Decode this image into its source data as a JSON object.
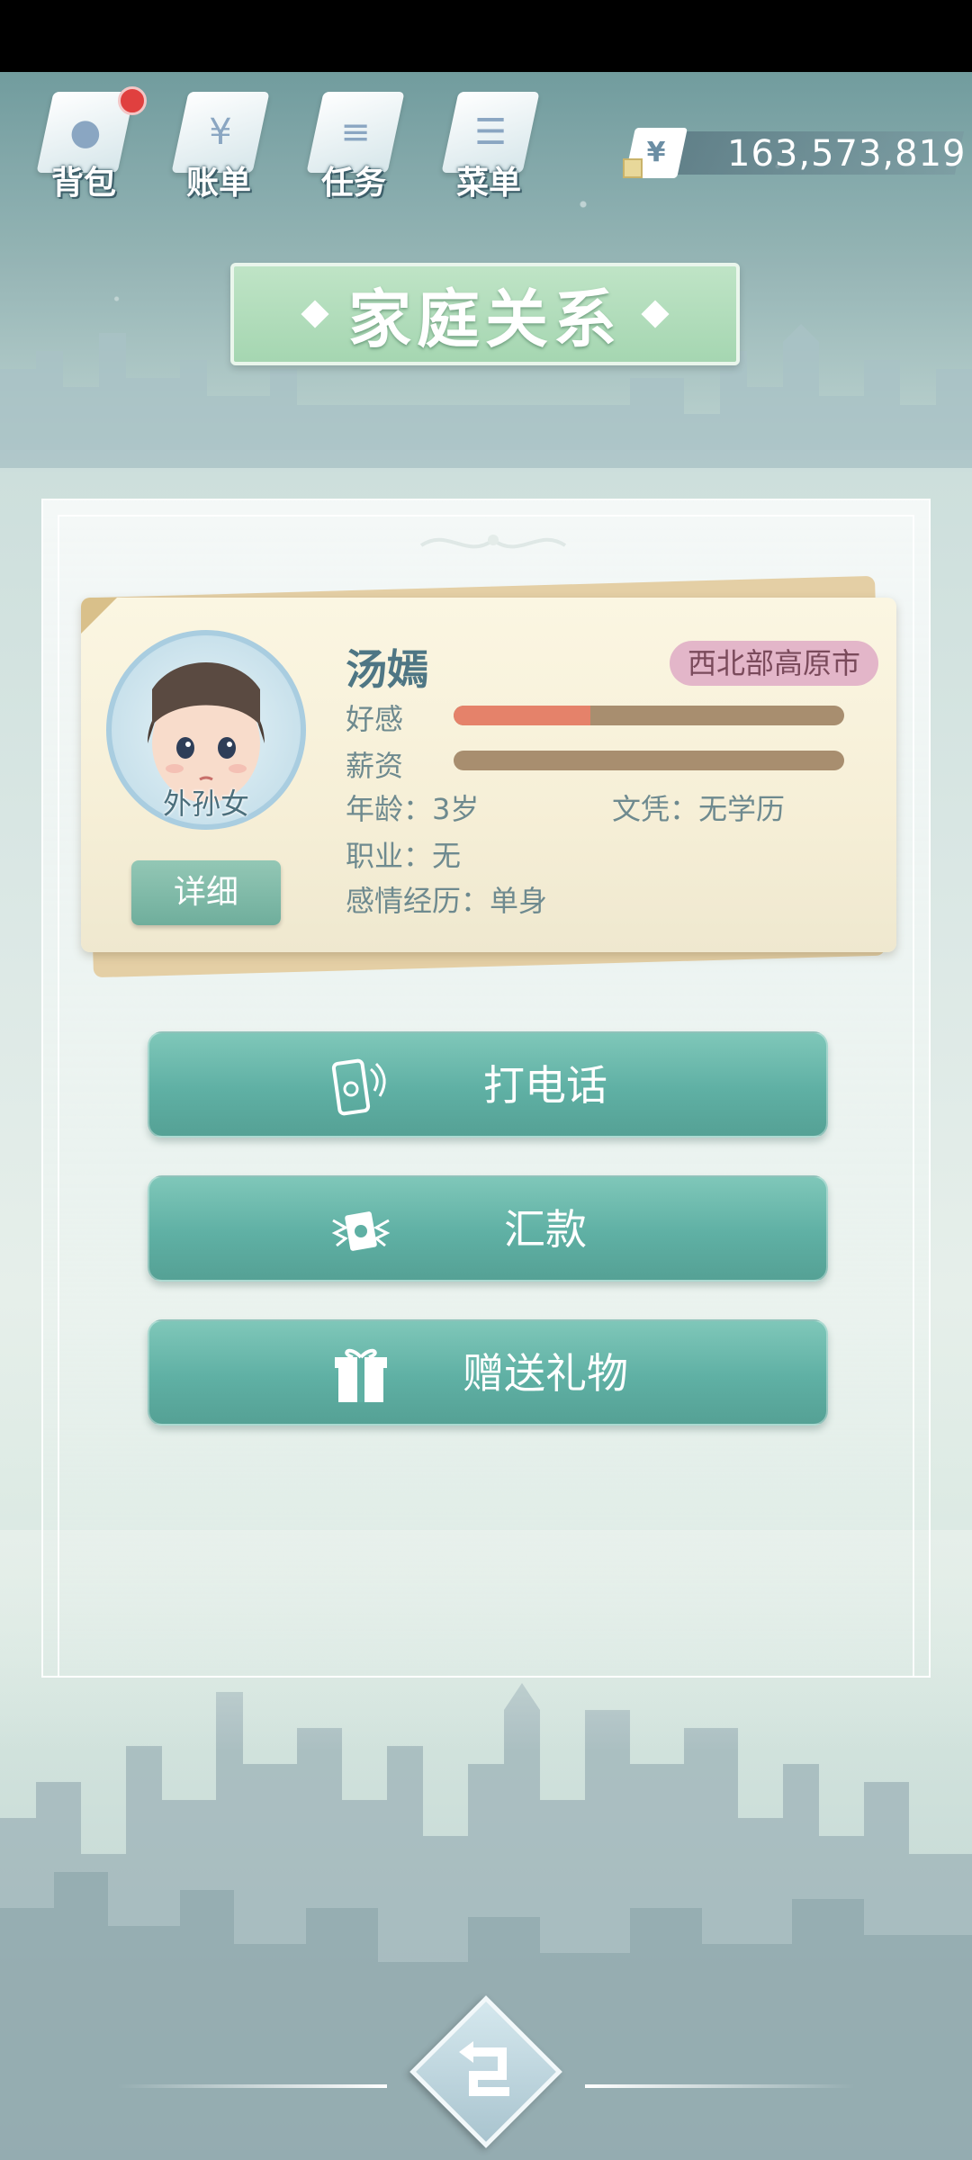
{
  "nav": {
    "items": [
      {
        "label": "背包",
        "icon": "bag-icon",
        "has_badge": true
      },
      {
        "label": "账单",
        "icon": "bill-icon",
        "has_badge": false
      },
      {
        "label": "任务",
        "icon": "task-icon",
        "has_badge": false
      },
      {
        "label": "菜单",
        "icon": "menu-icon",
        "has_badge": false
      }
    ]
  },
  "wallet": {
    "currency_symbol": "¥",
    "amount": "163,573,819"
  },
  "page": {
    "title": "家庭关系"
  },
  "profile": {
    "name": "汤嫣",
    "relation": "外孙女",
    "region": "西北部高原市",
    "favor_label": "好感",
    "favor_fraction": 0.35,
    "salary_label": "薪资",
    "salary_fraction": 0,
    "age": "年龄：3岁",
    "education": "文凭：无学历",
    "job": "职业：无",
    "relationship": "感情经历：单身",
    "detail_button": "详细"
  },
  "actions": [
    {
      "label": "打电话",
      "icon": "phone-icon"
    },
    {
      "label": "汇款",
      "icon": "money-transfer-icon"
    },
    {
      "label": "赠送礼物",
      "icon": "gift-icon"
    }
  ],
  "colors": {
    "accent_green": "#5fb0a4",
    "favor_bar": "#e5826a",
    "bar_track": "#a88e6f",
    "region_badge": "#e3b6c9"
  }
}
